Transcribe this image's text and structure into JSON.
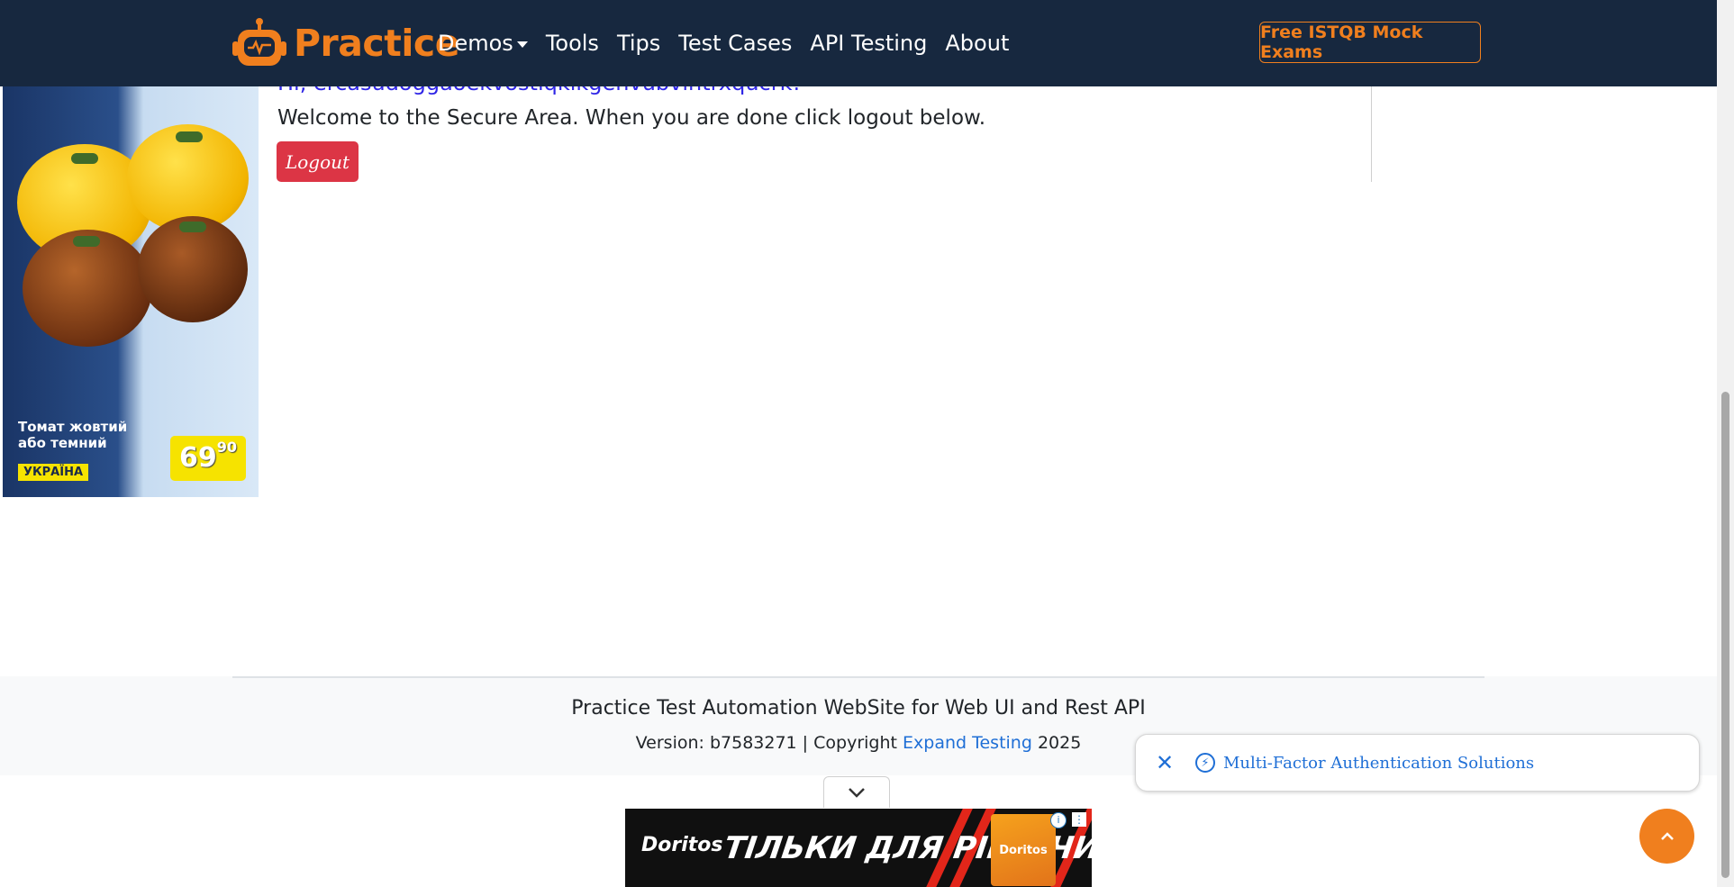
{
  "navbar": {
    "brand": "Practice",
    "links": [
      "Demos",
      "Tools",
      "Tips",
      "Test Cases",
      "API Testing",
      "About"
    ],
    "cta": "Free ISTQB Mock Exams"
  },
  "left_ad": {
    "caption_line1": "Томат жовтий",
    "caption_line2": "або темний",
    "country": "УКРАЇНА",
    "price_main": "69",
    "price_cents": "90"
  },
  "secure_area": {
    "greeting": "Hi, ercasudoggaoekvostiqkikgenvubvintrxqucrk!",
    "welcome": "Welcome to the Secure Area. When you are done click logout below.",
    "logout_label": "Logout"
  },
  "footer": {
    "title": "Practice Test Automation WebSite for Web UI and Rest API",
    "version_prefix": "Version: b7583271 | Copyright ",
    "company_link": "Expand Testing",
    "year": " 2025"
  },
  "mfa_popup": {
    "text": "Multi-Factor Authentication Solutions"
  },
  "bottom_ad": {
    "brand": "Doritos",
    "tagline": "ТІЛЬКИ ДЛЯ РІШУЧИХ",
    "bag_label": "Doritos"
  },
  "colors": {
    "navbar_bg": "#17283f",
    "accent_orange": "#f07f1e",
    "logout_red": "#dc3545",
    "greeting_blue": "#2f25e6",
    "link_blue": "#1f6fd6"
  }
}
